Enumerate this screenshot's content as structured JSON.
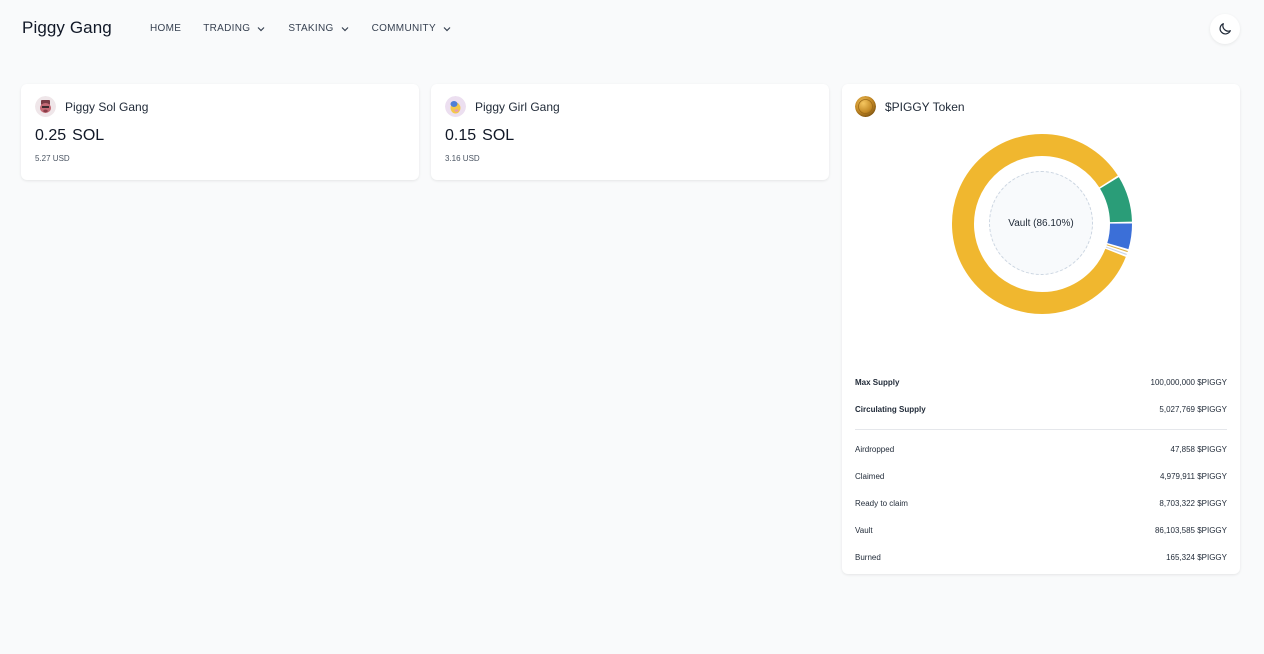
{
  "header": {
    "brand": "Piggy Gang",
    "nav": [
      {
        "label": "HOME",
        "has_dropdown": false
      },
      {
        "label": "TRADING",
        "has_dropdown": true
      },
      {
        "label": "STAKING",
        "has_dropdown": true
      },
      {
        "label": "COMMUNITY",
        "has_dropdown": true
      }
    ],
    "theme_icon": "moon-icon"
  },
  "collections": [
    {
      "name": "Piggy Sol Gang",
      "price": "0.25",
      "unit": "SOL",
      "usd": "5.27 USD",
      "icon": "piggy-sol-avatar"
    },
    {
      "name": "Piggy Girl Gang",
      "price": "0.15",
      "unit": "SOL",
      "usd": "3.16 USD",
      "icon": "piggy-girl-avatar"
    }
  ],
  "token": {
    "title": "$PIGGY Token",
    "icon": "piggy-coin-icon",
    "center_label": "Vault (86.10%)",
    "segments": [
      {
        "name": "Vault",
        "value": 86103585,
        "color": "#f0b72f"
      },
      {
        "name": "Ready to claim",
        "value": 8703322,
        "color": "#2a9d78"
      },
      {
        "name": "Claimed",
        "value": 4979911,
        "color": "#3b6fd8"
      },
      {
        "name": "Burned",
        "value": 165324,
        "color": "#e0b244"
      },
      {
        "name": "Airdropped",
        "value": 47858,
        "color": "#c9d3e6"
      }
    ],
    "summary": [
      {
        "label": "Max Supply",
        "value": "100,000,000 $PIGGY"
      },
      {
        "label": "Circulating Supply",
        "value": "5,027,769 $PIGGY"
      }
    ],
    "details": [
      {
        "label": "Airdropped",
        "value": "47,858 $PIGGY"
      },
      {
        "label": "Claimed",
        "value": "4,979,911 $PIGGY"
      },
      {
        "label": "Ready to claim",
        "value": "8,703,322 $PIGGY"
      },
      {
        "label": "Vault",
        "value": "86,103,585 $PIGGY"
      },
      {
        "label": "Burned",
        "value": "165,324 $PIGGY"
      }
    ]
  }
}
